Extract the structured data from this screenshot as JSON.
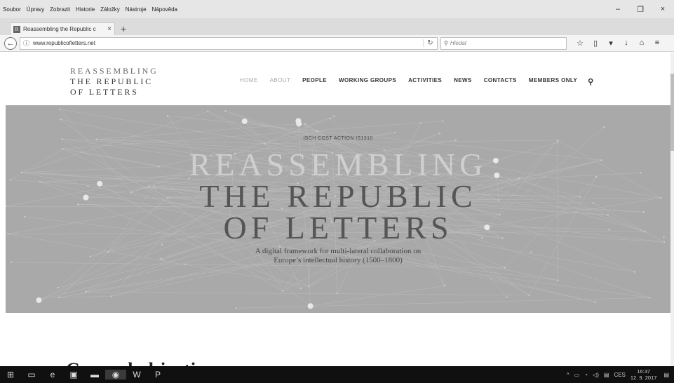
{
  "menubar": {
    "items": [
      "Soubor",
      "Úpravy",
      "Zobrazit",
      "Historie",
      "Záložky",
      "Nástroje",
      "Nápověda"
    ]
  },
  "window_controls": {
    "minimize": "–",
    "maximize": "❐",
    "close": "×"
  },
  "tab": {
    "favicon": "R",
    "title": "Reassembling the Republic c",
    "close": "×",
    "new_tab": "+"
  },
  "navbar": {
    "url": "www.republicofletters.net",
    "search_placeholder": "Hledat",
    "icons": [
      "back-icon",
      "info-icon",
      "reload-icon",
      "search-icon",
      "star-icon",
      "library-icon",
      "pocket-icon",
      "download-icon",
      "home-icon",
      "menu-icon"
    ]
  },
  "site": {
    "logo_line1": "REASSEMBLING",
    "logo_line2": "THE REPUBLIC",
    "logo_line3": "OF LETTERS",
    "nav": [
      "HOME",
      "ABOUT",
      "PEOPLE",
      "WORKING GROUPS",
      "ACTIVITIES",
      "NEWS",
      "CONTACTS",
      "MEMBERS ONLY"
    ],
    "nav_search_icon": "search-icon"
  },
  "hero": {
    "kicker": "ISCH COST ACTION IS1310",
    "line1": "REASSEMBLING",
    "line2": "THE REPUBLIC",
    "line3": "OF LETTERS",
    "subtitle1": "A digital framework for multi-lateral collaboration on",
    "subtitle2": "Europe’s intellectual history (1500–1800)",
    "background_color": "#a9a9a9"
  },
  "section": {
    "heading": "General objectives"
  },
  "taskbar": {
    "apps": [
      "start-icon",
      "task-view-icon",
      "edge-icon",
      "store-icon",
      "file-explorer-icon",
      "firefox-icon",
      "word-icon",
      "powerpoint-icon"
    ],
    "language": "CES",
    "time": "16:37",
    "date": "12. 9. 2017",
    "tray": [
      "chevron-up-icon",
      "battery-icon",
      "wifi-icon",
      "volume-icon",
      "keyboard-icon"
    ]
  }
}
